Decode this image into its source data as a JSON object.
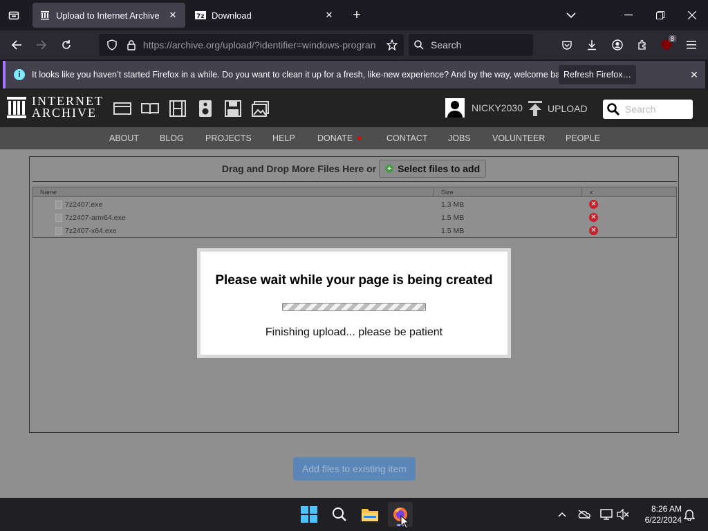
{
  "browser": {
    "tabs": [
      {
        "title": "Upload to Internet Archive",
        "active": true,
        "favicon": "archive-icon"
      },
      {
        "title": "Download",
        "active": false,
        "favicon": "7zip-icon"
      }
    ],
    "url_host": "https://archive.org",
    "url_path": "/upload/?identifier=windows-progran",
    "search_placeholder": "Search",
    "extension_badge": "8"
  },
  "notification": {
    "message": "It looks like you haven’t started Firefox in a while. Do you want to clean it up for a fresh, like-new experience? And by the way, welcome back!",
    "button": "Refresh Firefox…"
  },
  "ia": {
    "logo_line1": "INTERNET",
    "logo_line2": "ARCHIVE",
    "username": "NICKY2030",
    "upload_label": "UPLOAD",
    "search_placeholder": "Search",
    "nav": [
      "ABOUT",
      "BLOG",
      "PROJECTS",
      "HELP",
      "DONATE",
      "CONTACT",
      "JOBS",
      "VOLUNTEER",
      "PEOPLE"
    ],
    "media_icons": [
      "web-icon",
      "texts-icon",
      "video-icon",
      "audio-icon",
      "software-icon",
      "images-icon"
    ]
  },
  "upload": {
    "drop_text": "Drag and Drop More Files Here or",
    "select_button": "Select files to add",
    "columns": {
      "name": "Name",
      "size": "Size",
      "x": "x"
    },
    "files": [
      {
        "name": "7z2407.exe",
        "size": "1.3 MB"
      },
      {
        "name": "7z2407-arm64.exe",
        "size": "1.5 MB"
      },
      {
        "name": "7z2407-x64.exe",
        "size": "1.5 MB"
      }
    ],
    "modal_title": "Please wait while your page is being created",
    "modal_status": "Finishing upload... please be patient",
    "add_existing_button": "Add files to existing item"
  },
  "taskbar": {
    "time": "8:26 AM",
    "date": "6/22/2024"
  },
  "colors": {
    "accent_notification": "#a378ff",
    "delete_red": "#c6212a",
    "donate_heart": "#e00000",
    "add_button_blue": "#5b87b8"
  }
}
